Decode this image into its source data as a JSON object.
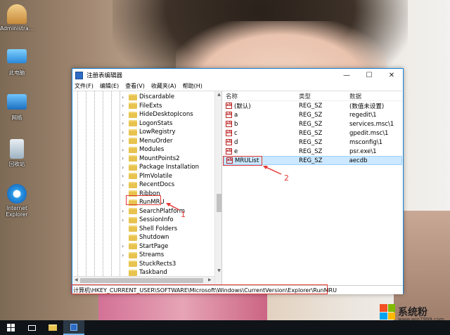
{
  "desktop": {
    "icons": [
      {
        "label": "Administra...",
        "icon": "user-icon"
      },
      {
        "label": "此电脑",
        "icon": "computer-icon"
      },
      {
        "label": "网络",
        "icon": "network-icon"
      },
      {
        "label": "回收站",
        "icon": "recycle-bin-icon"
      },
      {
        "label": "Internet Explorer",
        "icon": "ie-icon"
      }
    ]
  },
  "window": {
    "title": "注册表编辑器",
    "controls": {
      "minimize": "—",
      "maximize": "☐",
      "close": "✕"
    },
    "menu": [
      "文件(F)",
      "编辑(E)",
      "查看(V)",
      "收藏夹(A)",
      "帮助(H)"
    ]
  },
  "tree": {
    "items": [
      {
        "label": "Discardable",
        "expandable": true
      },
      {
        "label": "FileExts",
        "expandable": true
      },
      {
        "label": "HideDesktopIcons",
        "expandable": true
      },
      {
        "label": "LogonStats",
        "expandable": true
      },
      {
        "label": "LowRegistry",
        "expandable": true
      },
      {
        "label": "MenuOrder",
        "expandable": true
      },
      {
        "label": "Modules",
        "expandable": true
      },
      {
        "label": "MountPoints2",
        "expandable": true
      },
      {
        "label": "Package Installation",
        "expandable": true
      },
      {
        "label": "PlmVolatile",
        "expandable": true
      },
      {
        "label": "RecentDocs",
        "expandable": true
      },
      {
        "label": "Ribbon",
        "expandable": false
      },
      {
        "label": "RunMRU",
        "expandable": false
      },
      {
        "label": "SearchPlatform",
        "expandable": true
      },
      {
        "label": "SessionInfo",
        "expandable": true
      },
      {
        "label": "Shell Folders",
        "expandable": false
      },
      {
        "label": "Shutdown",
        "expandable": false
      },
      {
        "label": "StartPage",
        "expandable": true
      },
      {
        "label": "Streams",
        "expandable": true
      },
      {
        "label": "StuckRects3",
        "expandable": false
      },
      {
        "label": "Taskband",
        "expandable": false
      }
    ]
  },
  "values": {
    "headers": {
      "name": "名称",
      "type": "类型",
      "data": "数据"
    },
    "rows": [
      {
        "name": "(默认)",
        "type": "REG_SZ",
        "data": "(数值未设置)"
      },
      {
        "name": "a",
        "type": "REG_SZ",
        "data": "regedit\\1"
      },
      {
        "name": "b",
        "type": "REG_SZ",
        "data": "services.msc\\1"
      },
      {
        "name": "c",
        "type": "REG_SZ",
        "data": "gpedit.msc\\1"
      },
      {
        "name": "d",
        "type": "REG_SZ",
        "data": "msconfig\\1"
      },
      {
        "name": "e",
        "type": "REG_SZ",
        "data": "psr.exe\\1"
      },
      {
        "name": "MRUList",
        "type": "REG_SZ",
        "data": "aecdb"
      }
    ],
    "icon_text": "ab"
  },
  "status_path": "计算机\\HKEY_CURRENT_USER\\SOFTWARE\\Microsoft\\Windows\\CurrentVersion\\Explorer\\RunMRU",
  "annotations": {
    "one": "1",
    "two": "2"
  },
  "watermark": {
    "title": "系统粉",
    "url": "www.win7999.com"
  },
  "colors": {
    "accent": "#1883d7",
    "annotation": "#e53935",
    "folder": "#e8c34f"
  }
}
